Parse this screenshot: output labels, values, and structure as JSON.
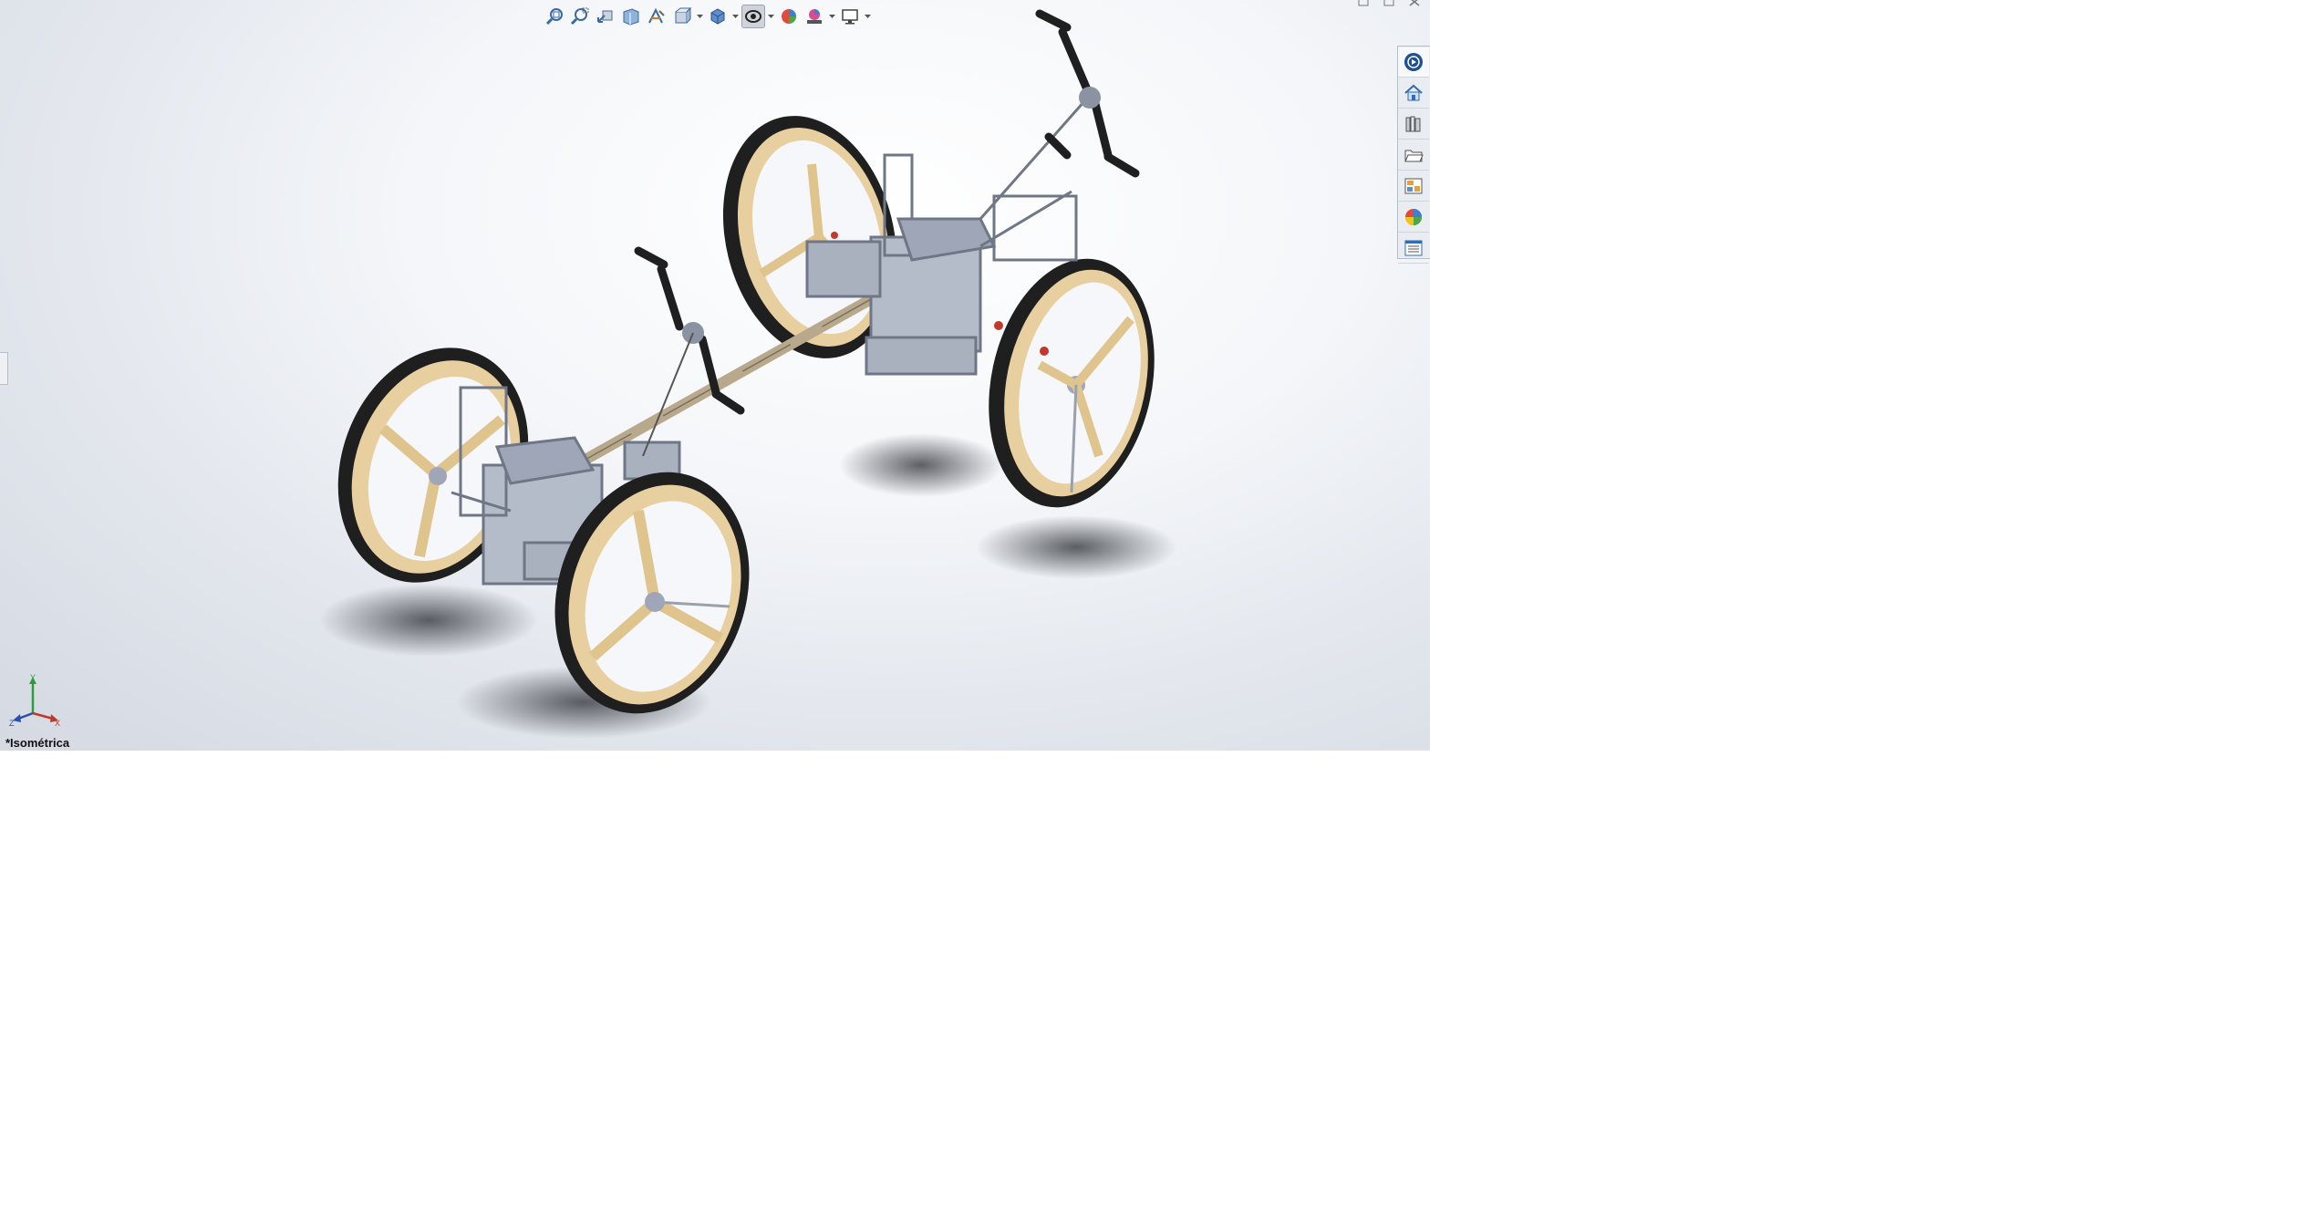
{
  "viewport": {
    "view_name": "*Isométrica"
  },
  "heads_up_toolbar": {
    "buttons": [
      {
        "icon": "zoom-to-fit-icon"
      },
      {
        "icon": "zoom-to-area-icon"
      },
      {
        "icon": "previous-view-icon"
      },
      {
        "icon": "section-view-icon"
      },
      {
        "icon": "dynamic-annotation-views-icon"
      },
      {
        "icon": "view-orientation-icon"
      },
      {
        "icon": "display-style-icon"
      },
      {
        "icon": "hide-show-items-icon"
      },
      {
        "icon": "edit-appearance-icon"
      },
      {
        "icon": "apply-scene-icon"
      },
      {
        "icon": "view-settings-icon"
      }
    ]
  },
  "task_pane": {
    "tabs": [
      {
        "icon": "solidworks-resources-icon"
      },
      {
        "icon": "home-icon"
      },
      {
        "icon": "design-library-icon"
      },
      {
        "icon": "file-explorer-icon"
      },
      {
        "icon": "view-palette-icon"
      },
      {
        "icon": "appearances-scenes-icon"
      },
      {
        "icon": "custom-properties-icon"
      }
    ]
  },
  "triad": {
    "axes": [
      "Y",
      "X",
      "Z"
    ]
  },
  "colors": {
    "wood": "#e8cf9f",
    "tire": "#1f1f1f",
    "frame": "#9ea6b8",
    "accent_red": "#c0392b"
  }
}
